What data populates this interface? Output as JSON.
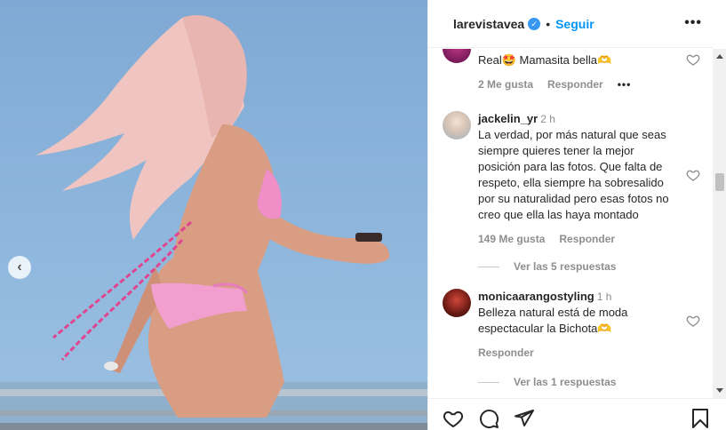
{
  "post": {
    "username": "larevistavea",
    "separator": "•",
    "follow_label": "Seguir",
    "more_label": "•••",
    "verified_icon": "verified-badge-icon"
  },
  "photo": {
    "prev_label": "‹"
  },
  "comments": [
    {
      "username": "",
      "time": "",
      "text": "Real🤩 Mamasita bella🫶",
      "likes": "2 Me gusta",
      "reply_label": "Responder",
      "more_label": "•••"
    },
    {
      "username": "jackelin_yr",
      "time": "2 h",
      "text": "La verdad, por más natural que seas siempre quieres tener la mejor posición para las fotos. Que falta de respeto, ella siempre ha sobresalido por su naturalidad pero esas fotos no creo que ella las haya montado",
      "likes": "149 Me gusta",
      "reply_label": "Responder",
      "view_replies": "Ver las 5 respuestas"
    },
    {
      "username": "monicaarangostyling",
      "time": "1 h",
      "text": "Belleza natural está de moda espectacular la Bichota🫶",
      "likes": "",
      "reply_label": "Responder",
      "view_replies": "Ver las 1 respuestas"
    }
  ],
  "actions": {
    "like_icon": "heart-icon",
    "comment_icon": "comment-icon",
    "share_icon": "share-icon",
    "save_icon": "bookmark-icon"
  },
  "colors": {
    "link": "#0095f6",
    "secondary_text": "#8e8e8e",
    "verified": "#3897f0"
  }
}
